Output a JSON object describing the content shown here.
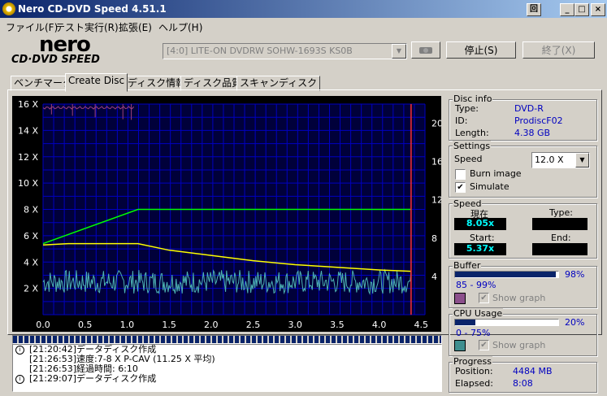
{
  "window": {
    "title": "Nero CD-DVD Speed 4.51.1",
    "restore_glyph": "回",
    "minimize_glyph": "_",
    "maximize_glyph": "□",
    "close_glyph": "×"
  },
  "menu": [
    "ファイル(F)",
    "テスト実行(R)",
    "拡張(E)",
    "ヘルプ(H)"
  ],
  "logo": {
    "line1": "nero",
    "line2": "CD·DVD SPEED"
  },
  "drive": {
    "selected": "[4:0]   LITE-ON DVDRW SOHW-1693S KS0B",
    "arrow": "▼"
  },
  "buttons": {
    "stop": "停止(S)",
    "exit": "終了(X)"
  },
  "tabs": [
    "ベンチマーク",
    "Create Disc",
    "ディスク情報",
    "ディスク品質",
    "スキャンディスク"
  ],
  "active_tab": "Create Disc",
  "disc_info": {
    "title": "Disc info",
    "type_label": "Type:",
    "type_value": "DVD-R",
    "id_label": "ID:",
    "id_value": "ProdiscF02",
    "length_label": "Length:",
    "length_value": "4.38 GB"
  },
  "settings": {
    "title": "Settings",
    "speed_label": "Speed",
    "speed_value": "12.0 X",
    "burn_image_label": "Burn image",
    "burn_image_checked": false,
    "simulate_label": "Simulate",
    "simulate_checked": true
  },
  "speed": {
    "title": "Speed",
    "current_label": "現在",
    "current_value": "8.05x",
    "type_label": "Type:",
    "type_value": "",
    "start_label": "Start:",
    "start_value": "5.37x",
    "end_label": "End:",
    "end_value": ""
  },
  "buffer": {
    "title": "Buffer",
    "percent": "98%",
    "fill": 0.98,
    "range": "85 - 99%",
    "show_graph_label": "Show graph",
    "swatch_color": "#8b4f8b"
  },
  "cpu": {
    "title": "CPU Usage",
    "percent": "20%",
    "fill": 0.2,
    "range": "0 - 75%",
    "show_graph_label": "Show graph",
    "swatch_color": "#3f8f8f"
  },
  "progress": {
    "title": "Progress",
    "position_label": "Position:",
    "position_value": "4484 MB",
    "elapsed_label": "Elapsed:",
    "elapsed_value": "8:08"
  },
  "log": [
    {
      "time": "[21:20:42]",
      "msg": "データディスク作成",
      "icon": true
    },
    {
      "time": "[21:26:53]",
      "msg": "速度:7-8 X P-CAV (11.25 X 平均)",
      "icon": false
    },
    {
      "time": "[21:26:53]",
      "msg": "経過時間:  6:10",
      "icon": false
    },
    {
      "time": "[21:29:07]",
      "msg": "データディスク作成",
      "icon": true
    }
  ],
  "chart_data": {
    "type": "line",
    "x_ticks": [
      "0.0",
      "0.5",
      "1.0",
      "1.5",
      "2.0",
      "2.5",
      "3.0",
      "3.5",
      "4.0",
      "4.5"
    ],
    "y_left_ticks": [
      "2 X",
      "4 X",
      "6 X",
      "8 X",
      "10 X",
      "12 X",
      "14 X",
      "16 X"
    ],
    "y_right_ticks": [
      "4",
      "8",
      "12",
      "16",
      "20"
    ],
    "xlim": [
      0,
      4.5
    ],
    "ylim_left": [
      0,
      16
    ],
    "ylim_right": [
      0,
      22
    ],
    "grid": true,
    "colors": {
      "write_speed": "#00ff00",
      "rpm": "#ffff00",
      "cpu": "#4db3b3",
      "buffer": "#a0407a",
      "marker": "#ff3030",
      "grid": "#0000c0",
      "plot_bg": "#00003a"
    },
    "series": [
      {
        "values_x": [
          0,
          1.13,
          4.38
        ],
        "values_y": [
          5.4,
          8.0,
          8.0
        ]
      },
      {
        "values_x": [
          0,
          0.3,
          1.13,
          1.5,
          2.0,
          2.5,
          3.0,
          3.5,
          4.0,
          4.38
        ],
        "values_y": [
          5.3,
          5.4,
          5.4,
          4.9,
          4.5,
          4.1,
          3.8,
          3.6,
          3.4,
          3.3
        ]
      }
    ],
    "cpu_baseline": 2.5,
    "marker_x": 4.38
  }
}
